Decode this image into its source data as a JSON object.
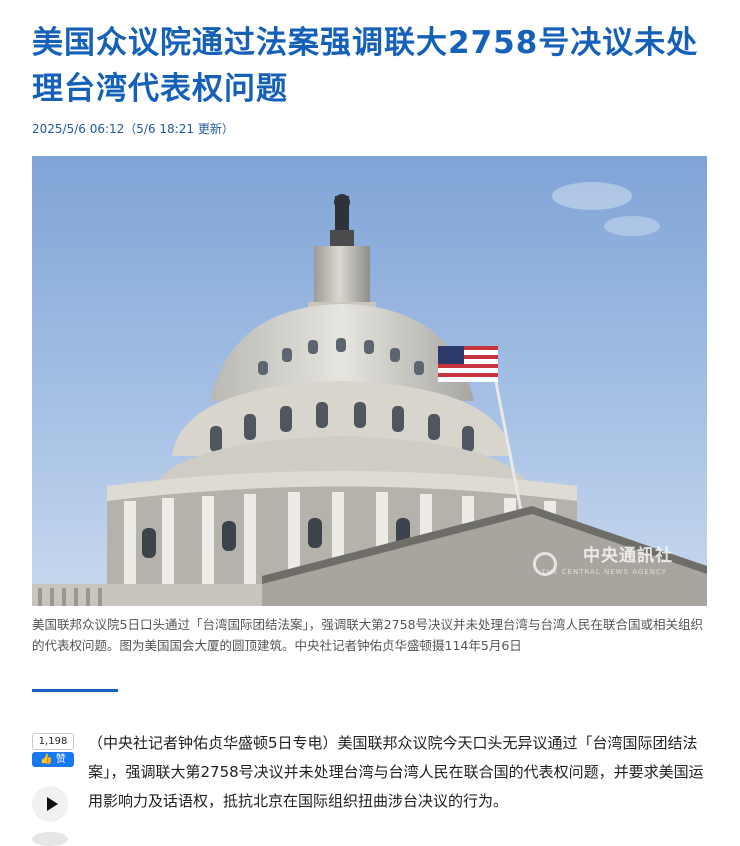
{
  "article": {
    "title": "美国众议院通过法案强调联大2758号决议未处理台湾代表权问题",
    "dateline": "2025/5/6 06:12（5/6 18:21 更新）",
    "photo_watermark": "中央通訊社",
    "photo_watermark_sub": "THE CENTRAL NEWS AGENCY",
    "caption": "美国联邦众议院5日口头通过「台湾国际团结法案」，强调联大第2758号决议并未处理台湾与台湾人民在联合国或相关组织的代表权问题。图为美国国会大厦的圆顶建筑。中央社记者钟佑贞华盛顿摄114年5月6日",
    "lead": "（中央社记者钟佑贞华盛顿5日专电）美国联邦众议院今天口头无异议通过「台湾国际团结法案」，强调联大第2758号决议并未处理台湾与台湾人民在联合国的代表权问题，并要求美国运用影响力及话语权，抵抗北京在国际组织扭曲涉台决议的行为。"
  },
  "social": {
    "like_count": "1,198",
    "like_label": "赞"
  },
  "icons": {
    "thumb": "thumbs-up-icon",
    "play": "play-icon"
  },
  "colors": {
    "title": "#1560b8",
    "accent_bar": "#1560b8",
    "facebook": "#1877f2"
  }
}
